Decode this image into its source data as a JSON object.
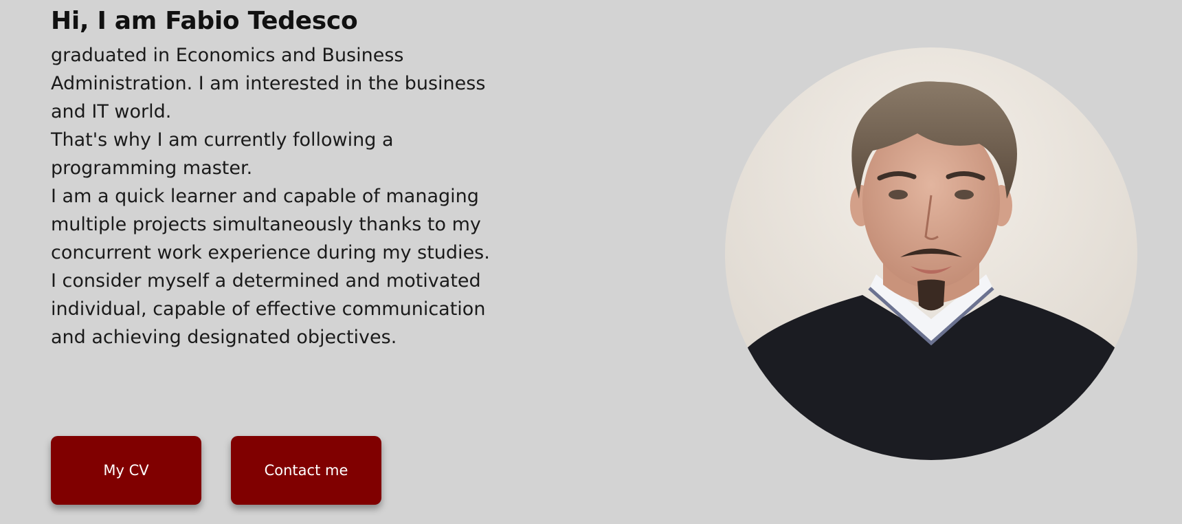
{
  "hero": {
    "title": "Hi, I am Fabio Tedesco",
    "bio_paragraphs": [
      "graduated in Economics and Business Administration. I am interested in the business and IT world.",
      "That's why I am currently following a programming master.",
      "I am a quick learner and capable of managing multiple projects simultaneously thanks to my concurrent work experience during my studies.",
      "I consider myself a determined and motivated individual, capable of effective communication and achieving designated objectives."
    ],
    "buttons": {
      "cv_label": "My CV",
      "contact_label": "Contact me"
    }
  },
  "colors": {
    "background": "#d3d3d3",
    "button": "#800000",
    "button_text": "#ffffff"
  }
}
